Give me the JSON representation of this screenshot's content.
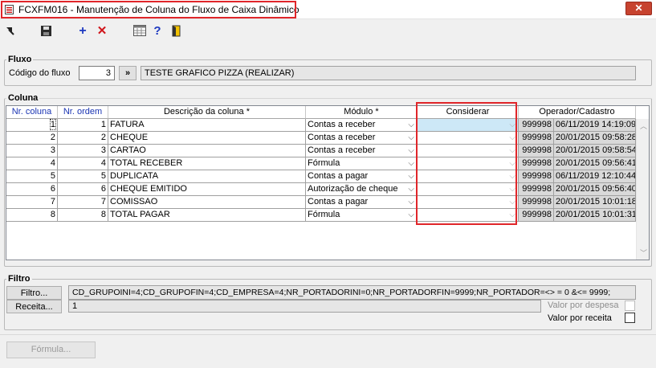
{
  "window": {
    "title": "FCXFM016 - Manutenção de Coluna do Fluxo de Caixa Dinâmico",
    "close_glyph": "✕"
  },
  "toolbar": [
    "export-icon",
    "save-icon",
    "add-icon",
    "delete-icon",
    "calculator-icon",
    "help-icon",
    "exit-icon"
  ],
  "fluxo": {
    "group_label": "Fluxo",
    "codigo_label": "Código do fluxo",
    "codigo_value": "3",
    "lookup_button": "»",
    "descricao": "TESTE GRAFICO PIZZA (REALIZAR)"
  },
  "coluna": {
    "group_label": "Coluna",
    "headers": {
      "nr_coluna": "Nr. coluna",
      "nr_ordem": "Nr. ordem",
      "descricao": "Descrição da coluna *",
      "modulo": "Módulo *",
      "considerar": "Considerar",
      "operador": "Operador/Cadastro"
    },
    "rows": [
      {
        "nr_coluna": "1",
        "nr_ordem": "1",
        "descricao": "FATURA",
        "modulo": "Contas a receber",
        "considerar": "",
        "operador": "999998",
        "cadastro": "06/11/2019 14:19:09"
      },
      {
        "nr_coluna": "2",
        "nr_ordem": "2",
        "descricao": "CHEQUE",
        "modulo": "Contas a receber",
        "considerar": "",
        "operador": "999998",
        "cadastro": "20/01/2015 09:58:28"
      },
      {
        "nr_coluna": "3",
        "nr_ordem": "3",
        "descricao": "CARTAO",
        "modulo": "Contas a receber",
        "considerar": "",
        "operador": "999998",
        "cadastro": "20/01/2015 09:58:54"
      },
      {
        "nr_coluna": "4",
        "nr_ordem": "4",
        "descricao": "TOTAL RECEBER",
        "modulo": "Fórmula",
        "considerar": "",
        "operador": "999998",
        "cadastro": "20/01/2015 09:56:41"
      },
      {
        "nr_coluna": "5",
        "nr_ordem": "5",
        "descricao": "DUPLICATA",
        "modulo": "Contas a pagar",
        "considerar": "",
        "operador": "999998",
        "cadastro": "06/11/2019 12:10:44"
      },
      {
        "nr_coluna": "6",
        "nr_ordem": "6",
        "descricao": "CHEQUE EMITIDO",
        "modulo": "Autorização de cheque",
        "considerar": "",
        "operador": "999998",
        "cadastro": "20/01/2015 09:56:40"
      },
      {
        "nr_coluna": "7",
        "nr_ordem": "7",
        "descricao": "COMISSAO",
        "modulo": "Contas a pagar",
        "considerar": "",
        "operador": "999998",
        "cadastro": "20/01/2015 10:01:18"
      },
      {
        "nr_coluna": "8",
        "nr_ordem": "8",
        "descricao": "TOTAL PAGAR",
        "modulo": "Fórmula",
        "considerar": "",
        "operador": "999998",
        "cadastro": "20/01/2015 10:01:31"
      }
    ]
  },
  "filtro": {
    "group_label": "Filtro",
    "filtro_button": "Filtro...",
    "filtro_value": "CD_GRUPOINI=4;CD_GRUPOFIN=4;CD_EMPRESA=4;NR_PORTADORINI=0;NR_PORTADORFIN=9999;NR_PORTADOR=<> = 0 &<= 9999;",
    "receita_button": "Receita...",
    "receita_value": "1",
    "valor_despesa_label": "Valor por despesa",
    "valor_receita_label": "Valor por receita"
  },
  "bottom": {
    "formula_button": "Fórmula..."
  },
  "colors": {
    "highlight": "#e0262a",
    "header_blue": "#1a34b3",
    "close_red": "#c7432f"
  }
}
